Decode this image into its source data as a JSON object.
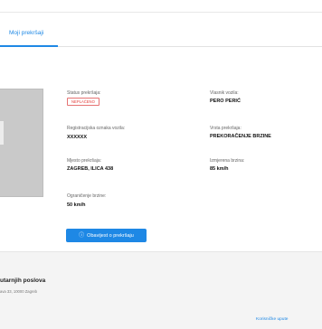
{
  "tabs": {
    "active_label": "Moji prekršaji"
  },
  "violation": {
    "status_label": "Status prekršaja:",
    "status_value": "NEPLAĆENO",
    "owner_label": "Vlasnik vozila:",
    "owner_value": "PERO PERIĆ",
    "registration_label": "Registracijska oznaka vozila:",
    "registration_value": "XXXXXX",
    "type_label": "Vrsta prekršaja:",
    "type_value": "PREKORAČENJE BRZINE",
    "location_label": "Mjesto prekršaja:",
    "location_value": "ZAGREB, ILICA 438",
    "measured_speed_label": "Izmjerena brzina:",
    "measured_speed_value": "85 km/h",
    "speed_limit_label": "Ograničenje brzine:",
    "speed_limit_value": "50 km/h"
  },
  "actions": {
    "notify_label": "Obavijest o prekršaju",
    "notify_icon": "info-icon"
  },
  "footer": {
    "title": "utarnjih poslova",
    "address": "ava 33, 10000 Zagreb",
    "help_link": "Korisničke upute"
  },
  "colors": {
    "accent": "#1e88e5",
    "status_unpaid": "#e53935",
    "footer_bg": "#f4f4f4",
    "photo_placeholder": "#c9c9c9"
  }
}
